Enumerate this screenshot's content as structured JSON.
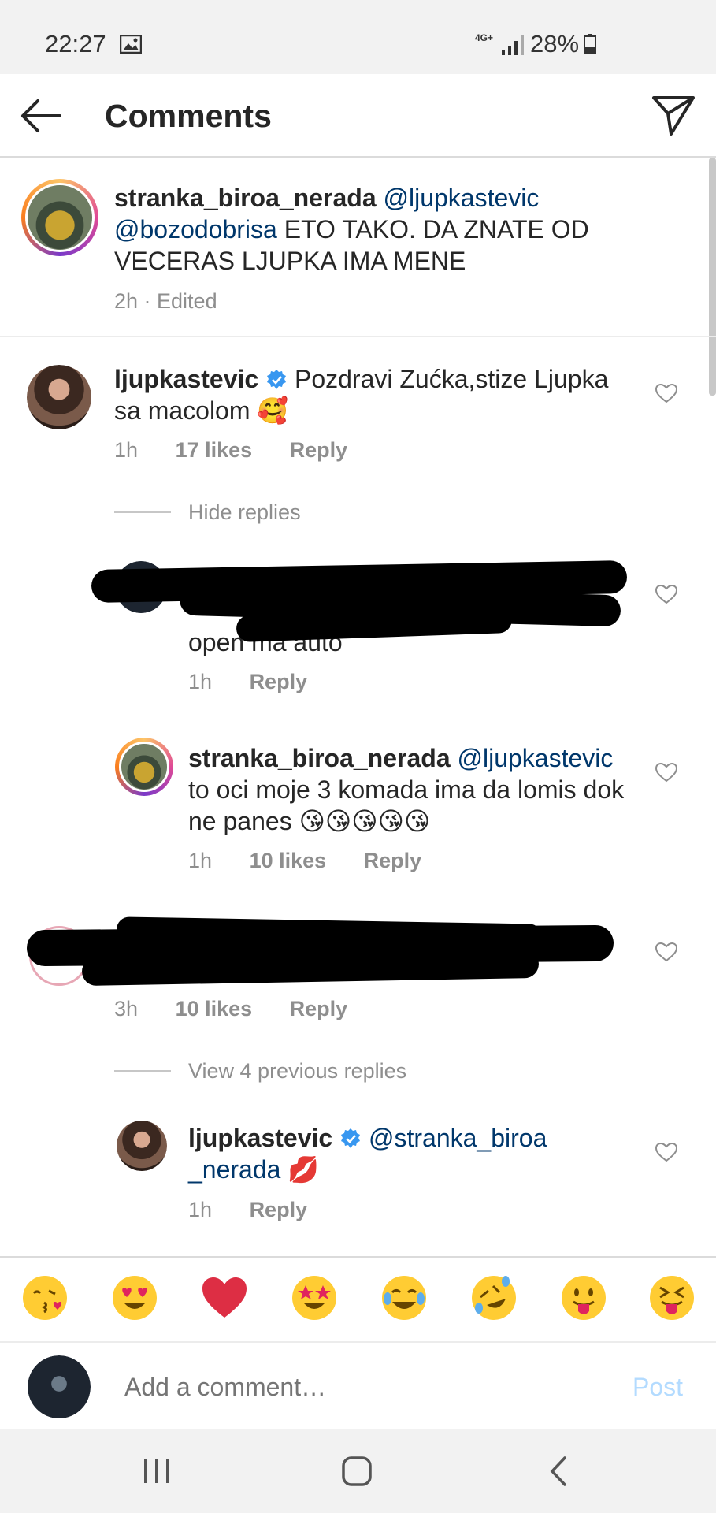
{
  "status_bar": {
    "time": "22:27",
    "network": "4G+",
    "battery": "28%"
  },
  "header": {
    "title": "Comments"
  },
  "caption": {
    "username": "stranka_biroa_nerada",
    "mention1": "@ljupkastevic",
    "mention2": "@bozodobrisa",
    "text": "ETO TAKO. DA ZNATE OD VECERAS LJUPKA IMA MENE",
    "meta": "2h · Edited"
  },
  "comments": [
    {
      "username": "ljupkastevic",
      "text": "Pozdravi Zućka,stize Ljupka sa macolom 🥰",
      "time": "1h",
      "likes": "17 likes",
      "reply": "Reply",
      "replies_link": "Hide replies"
    },
    {
      "redacted_visible_text": "open ma auto",
      "time": "1h",
      "reply": "Reply"
    },
    {
      "username": "stranka_biroa_nerada",
      "mention": "@ljupkastevic",
      "text": "to oci moje 3 komada ima da lomis dok ne panes 😘😘😘😘😘",
      "time": "1h",
      "likes": "10 likes",
      "reply": "Reply"
    },
    {
      "time": "3h",
      "likes": "10 likes",
      "reply": "Reply",
      "replies_link": "View 4 previous replies"
    },
    {
      "username": "ljupkastevic",
      "mention": "@stranka_biroa _nerada",
      "text": "💋",
      "time": "1h",
      "reply": "Reply"
    }
  ],
  "emoji_bar": [
    "😘",
    "😍",
    "❤️",
    "🤩",
    "😂",
    "🤣",
    "😛",
    "😝"
  ],
  "comment_bar": {
    "placeholder": "Add a comment…",
    "post_label": "Post"
  },
  "colors": {
    "mention": "#00376b",
    "secondary_text": "#8e8e8e",
    "verified": "#3897f0",
    "post_disabled": "#b3dbff"
  }
}
